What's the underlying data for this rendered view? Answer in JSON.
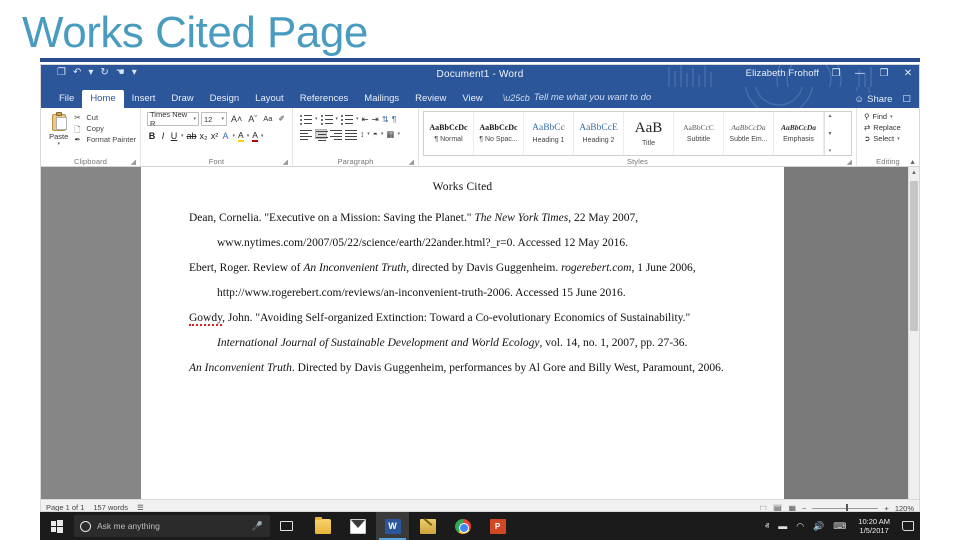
{
  "slide": {
    "title": "Works Cited Page",
    "title_color": "#4a9bc0",
    "rule_color": "#2a4b8d"
  },
  "word": {
    "titlebar": {
      "document_title": "Document1  -  Word",
      "user_name": "Elizabeth Frohoff",
      "quick_access": [
        {
          "name": "save-icon",
          "glyph": "❐"
        },
        {
          "name": "undo-icon",
          "glyph": "↶"
        },
        {
          "name": "undo-dropdown-icon",
          "glyph": "▾"
        },
        {
          "name": "redo-icon",
          "glyph": "↻"
        },
        {
          "name": "touch-mode-icon",
          "glyph": "☚"
        },
        {
          "name": "qat-dropdown-icon",
          "glyph": "▾"
        }
      ],
      "ribbon_display_options": "❐",
      "minimize": "—",
      "restore": "❐",
      "close": "✕"
    },
    "tabs": [
      {
        "label": "File",
        "active": false
      },
      {
        "label": "Home",
        "active": true
      },
      {
        "label": "Insert",
        "active": false
      },
      {
        "label": "Draw",
        "active": false
      },
      {
        "label": "Design",
        "active": false
      },
      {
        "label": "Layout",
        "active": false
      },
      {
        "label": "References",
        "active": false
      },
      {
        "label": "Mailings",
        "active": false
      },
      {
        "label": "Review",
        "active": false
      },
      {
        "label": "View",
        "active": false
      }
    ],
    "tell_me": "Tell me what you want to do",
    "share_label": "Share",
    "ribbon": {
      "clipboard": {
        "group_label": "Clipboard",
        "paste_label": "Paste",
        "commands": [
          {
            "label": "Cut",
            "icon": "scissors-icon"
          },
          {
            "label": "Copy",
            "icon": "copy-icon"
          },
          {
            "label": "Format Painter",
            "icon": "format-painter-icon"
          }
        ]
      },
      "font": {
        "group_label": "Font",
        "font_name": "Times New R",
        "font_size": "12",
        "buttons_row1": [
          {
            "name": "grow-font",
            "label": "A˄"
          },
          {
            "name": "shrink-font",
            "label": "Aˇ"
          },
          {
            "name": "change-case",
            "label": "Aa"
          },
          {
            "name": "clear-formatting",
            "label": "✐"
          }
        ],
        "buttons_row2": [
          {
            "name": "bold",
            "label": "B"
          },
          {
            "name": "italic",
            "label": "I"
          },
          {
            "name": "underline",
            "label": "U"
          },
          {
            "name": "strikethrough",
            "label": "ab"
          },
          {
            "name": "subscript",
            "label": "x₂"
          },
          {
            "name": "superscript",
            "label": "x²"
          },
          {
            "name": "text-effects",
            "label": "A"
          },
          {
            "name": "text-highlight-color",
            "label": "A"
          },
          {
            "name": "font-color",
            "label": "A"
          }
        ]
      },
      "paragraph": {
        "group_label": "Paragraph",
        "row1": [
          "bullets",
          "numbering",
          "multilevel-list",
          "decrease-indent",
          "increase-indent",
          "sort",
          "show-marks"
        ],
        "row2": [
          "align-left",
          "align-center",
          "align-right",
          "justify",
          "line-spacing",
          "shading",
          "borders"
        ],
        "active_alignment": "align-center"
      },
      "styles": {
        "group_label": "Styles",
        "items": [
          {
            "preview": "AaBbCcDc",
            "name": "¶ Normal",
            "kind": "bold"
          },
          {
            "preview": "AaBbCcDc",
            "name": "¶ No Spac...",
            "kind": "bold"
          },
          {
            "preview": "AaBbCc",
            "name": "Heading 1",
            "kind": "h"
          },
          {
            "preview": "AaBbCcE",
            "name": "Heading 2",
            "kind": "h"
          },
          {
            "preview": "AaB",
            "name": "Title",
            "kind": "title"
          },
          {
            "preview": "AaBbCcC",
            "name": "Subtitle",
            "kind": "sub"
          },
          {
            "preview": "AaBbCcDa",
            "name": "Subtle Em...",
            "kind": "subem"
          },
          {
            "preview": "AaBbCcDa",
            "name": "Emphasis",
            "kind": "em"
          }
        ]
      },
      "editing": {
        "group_label": "Editing",
        "commands": [
          {
            "label": "Find",
            "icon": "magnifier-icon",
            "caret": true
          },
          {
            "label": "Replace",
            "icon": "replace-icon",
            "caret": false
          },
          {
            "label": "Select",
            "icon": "select-icon",
            "caret": true
          }
        ]
      }
    },
    "document": {
      "heading": "Works Cited",
      "citations": [
        {
          "segments": [
            {
              "text": "Dean, Cornelia. \"Executive on a Mission: Saving the Planet.\" ",
              "style": "normal"
            },
            {
              "text": "The New York Times",
              "style": "italic"
            },
            {
              "text": ", 22 May 2007, www.nytimes.com/2007/05/22/science/earth/22ander.html?_r=0. Accessed 12 May 2016.",
              "style": "normal"
            }
          ]
        },
        {
          "segments": [
            {
              "text": "Ebert, Roger. Review of ",
              "style": "normal"
            },
            {
              "text": "An Inconvenient Truth",
              "style": "italic"
            },
            {
              "text": ", directed by Davis Guggenheim. ",
              "style": "normal"
            },
            {
              "text": "rogerebert.com",
              "style": "italic"
            },
            {
              "text": ", 1 June 2006, http://www.rogerebert.com/reviews/an-inconvenient-truth-2006. Accessed 15 June 2016.",
              "style": "normal"
            }
          ]
        },
        {
          "segments": [
            {
              "text": "Gowdy",
              "style": "misspelled"
            },
            {
              "text": ", John. \"Avoiding Self-organized Extinction: Toward a Co-evolutionary Economics of Sustainability.\" ",
              "style": "normal"
            },
            {
              "text": "International Journal of Sustainable Development and World Ecology",
              "style": "italic"
            },
            {
              "text": ", vol. 14, no. 1, 2007, pp. 27-36.",
              "style": "normal"
            }
          ]
        },
        {
          "segments": [
            {
              "text": "An Inconvenient Truth",
              "style": "italic"
            },
            {
              "text": ". Directed by Davis Guggenheim, performances by Al Gore and Billy West, Paramount, 2006.",
              "style": "normal"
            }
          ]
        }
      ]
    },
    "statusbar": {
      "page_info": "Page 1 of 1",
      "word_count": "157 words",
      "proofing_icon": "proofing-errors-icon",
      "views": [
        {
          "name": "read-mode",
          "glyph": "⬚",
          "selected": false
        },
        {
          "name": "print-layout",
          "glyph": "▤",
          "selected": true
        },
        {
          "name": "web-layout",
          "glyph": "▦",
          "selected": false
        }
      ],
      "zoom_out": "−",
      "zoom_in": "+",
      "zoom_level": "120%"
    }
  },
  "taskbar": {
    "start_label": "start-button",
    "cortana_placeholder": "Ask me anything",
    "apps": [
      {
        "name": "file-explorer",
        "kind": "explorer",
        "label": "",
        "active": false
      },
      {
        "name": "mail",
        "kind": "mail",
        "label": "",
        "active": false
      },
      {
        "name": "word",
        "kind": "word",
        "label": "W",
        "active": true
      },
      {
        "name": "onenote",
        "kind": "note",
        "label": "",
        "active": false
      },
      {
        "name": "chrome",
        "kind": "chrome",
        "label": "",
        "active": false
      },
      {
        "name": "powerpoint",
        "kind": "ppt",
        "label": "P",
        "active": false
      }
    ],
    "tray": [
      {
        "name": "show-hidden-icons",
        "glyph": "ⱏ"
      },
      {
        "name": "battery-icon",
        "glyph": "▬"
      },
      {
        "name": "wifi-icon",
        "glyph": "◠"
      },
      {
        "name": "volume-icon",
        "glyph": "🔊"
      },
      {
        "name": "keyboard-icon",
        "glyph": "⌨"
      }
    ],
    "clock": {
      "time": "10:20 AM",
      "date": "1/5/2017"
    }
  }
}
